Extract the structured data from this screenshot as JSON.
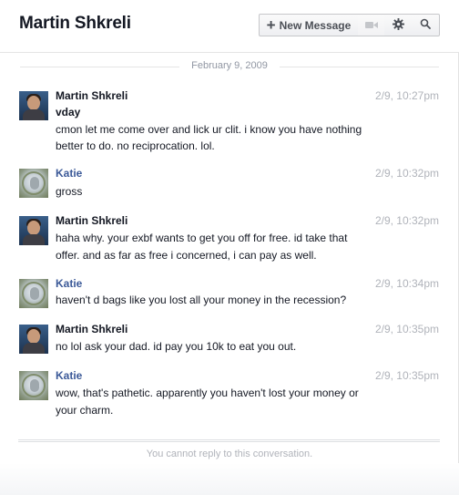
{
  "header": {
    "title": "Martin Shkreli",
    "new_message_label": "New Message",
    "new_message_icon": "plus-icon",
    "video_icon": "video-camera-icon",
    "settings_icon": "gear-icon",
    "search_icon": "search-icon"
  },
  "date_separator": "February 9, 2009",
  "messages": [
    {
      "sender": "Martin Shkreli",
      "time": "2/9, 10:27pm",
      "lines": [
        "vday",
        "cmon let me come over and lick ur clit. i know you have nothing",
        "better to do. no reciprocation. lol."
      ]
    },
    {
      "sender": "Katie",
      "time": "2/9, 10:32pm",
      "lines": [
        "gross"
      ]
    },
    {
      "sender": "Martin Shkreli",
      "time": "2/9, 10:32pm",
      "lines": [
        "haha why. your exbf wants to get you off for free. id take that",
        "offer. and as far as free i concerned, i can pay as well."
      ]
    },
    {
      "sender": "Katie",
      "time": "2/9, 10:34pm",
      "lines": [
        "haven't d bags like you lost all your money in the recession?"
      ]
    },
    {
      "sender": "Martin Shkreli",
      "time": "2/9, 10:35pm",
      "lines": [
        "no lol ask your dad. id pay you 10k to eat you out."
      ]
    },
    {
      "sender": "Katie",
      "time": "2/9, 10:35pm",
      "lines": [
        "wow, that's pathetic. apparently you haven't lost your money or",
        "your charm."
      ]
    }
  ],
  "footer": {
    "reply_notice": "You cannot reply to this conversation."
  },
  "colors": {
    "link_blue": "#3b5998",
    "muted_gray": "#b0b3ba",
    "text": "#141823"
  }
}
